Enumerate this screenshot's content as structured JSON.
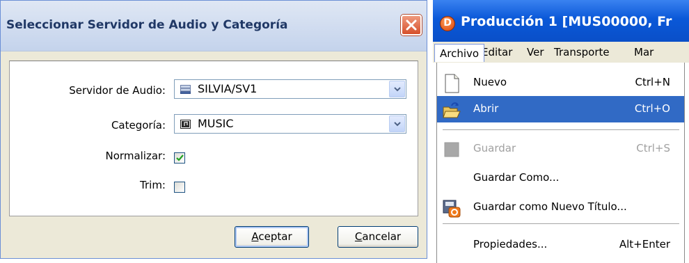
{
  "dialog": {
    "title": "Seleccionar Servidor de Audio y Categoría",
    "close_icon": "close-icon",
    "fields": {
      "servidor_label": "Servidor de Audio:",
      "servidor_value": "SILVIA/SV1",
      "categoria_label": "Categoría:",
      "categoria_value": "MUSIC",
      "normalizar_label": "Normalizar:",
      "normalizar_checked": true,
      "trim_label": "Trim:",
      "trim_checked": false
    },
    "buttons": {
      "aceptar_accel": "A",
      "aceptar_rest": "ceptar",
      "cancelar_accel": "C",
      "cancelar_rest": "ancelar"
    }
  },
  "window": {
    "title": "Producción 1 [MUS00000, Fr",
    "app_icon_letter": "D",
    "menubar": [
      "Archivo",
      "Editar",
      "Ver",
      "Transporte",
      "Mar"
    ]
  },
  "menu": {
    "items": [
      {
        "label": "Nuevo",
        "shortcut": "Ctrl+N",
        "icon": "new-document-icon",
        "state": "normal"
      },
      {
        "label": "Abrir",
        "shortcut": "Ctrl+O",
        "icon": "open-folder-icon",
        "state": "selected"
      },
      {
        "label": "Guardar",
        "shortcut": "Ctrl+S",
        "icon": "save-icon",
        "state": "disabled"
      },
      {
        "label": "Guardar Como...",
        "shortcut": "",
        "icon": "",
        "state": "normal"
      },
      {
        "label": "Guardar como Nuevo Título...",
        "shortcut": "",
        "icon": "save-new-title-icon",
        "state": "normal"
      },
      {
        "label": "Propiedades...",
        "shortcut": "Alt+Enter",
        "icon": "",
        "state": "normal"
      }
    ]
  },
  "colors": {
    "menu_selection": "#316ac5",
    "titlebar_blue": "#0a58d8",
    "dialog_face": "#ece9d8"
  }
}
